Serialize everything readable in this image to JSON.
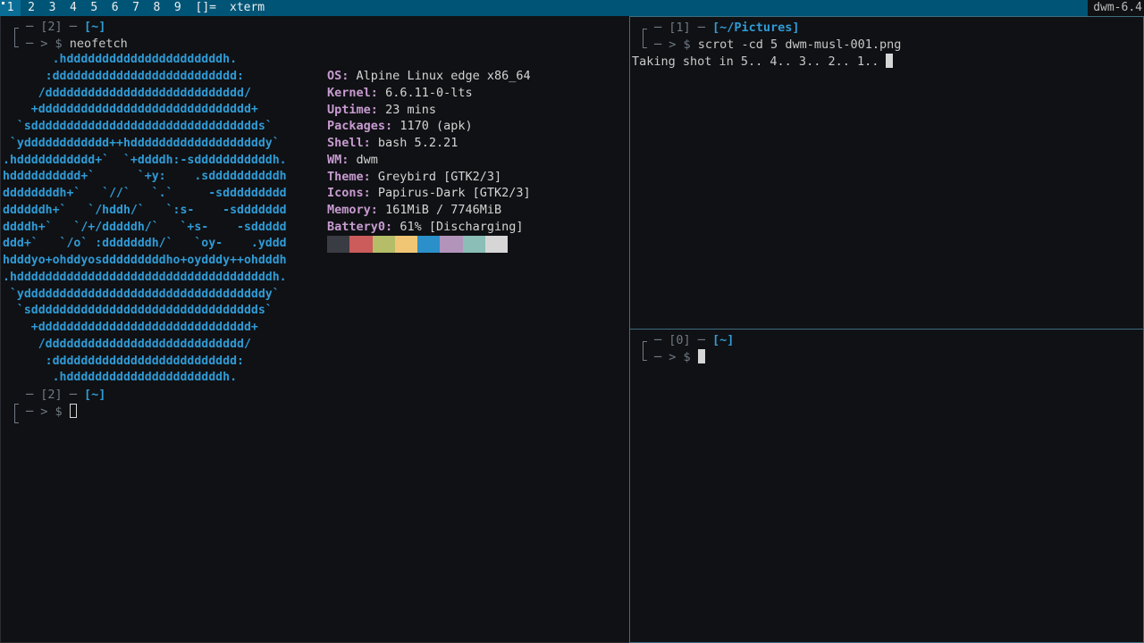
{
  "bar": {
    "tags": [
      "1",
      "2",
      "3",
      "4",
      "5",
      "6",
      "7",
      "8",
      "9"
    ],
    "selected_tag": 0,
    "layout_symbol": "[]=",
    "window_title": "xterm",
    "status": "dwm-6.4"
  },
  "main": {
    "prompt1": {
      "prefix": "─ [2] ─ ",
      "dir": "[~]",
      "arrow": "─ > $ ",
      "command": "neofetch"
    },
    "ascii": [
      "       .hddddddddddddddddddddddh.",
      "      :dddddddddddddddddddddddddd:",
      "     /dddddddddddddddddddddddddddd/",
      "    +dddddddddddddddddddddddddddddd+",
      "  `sdddddddddddddddddddddddddddddddds`",
      " `ydddddddddddd++hdddddddddddddddddddy`",
      ".hddddddddddd+`  `+ddddh:-sdddddddddddh.",
      "hdddddddddd+`      `+y:    .sddddddddddh",
      "ddddddddh+`   `//`   `.`     -sddddddddd",
      "ddddddh+`   `/hddh/`   `:s-    -sddddddd",
      "ddddh+`   `/+/dddddh/`   `+s-    -sddddd",
      "ddd+`   `/o` :dddddddh/`   `oy-    .yddd",
      "hdddyo+ohddyosdddddddddho+oydddy++ohdddh",
      ".hddddddddddddddddddddddddddddddddddddh.",
      " `yddddddddddddddddddddddddddddddddddy`",
      "  `sdddddddddddddddddddddddddddddddds`",
      "    +dddddddddddddddddddddddddddddd+",
      "     /dddddddddddddddddddddddddddd/",
      "      :dddddddddddddddddddddddddd:",
      "       .hddddddddddddddddddddddh."
    ],
    "info": [
      {
        "key": "OS",
        "value": "Alpine Linux edge x86_64"
      },
      {
        "key": "Kernel",
        "value": "6.6.11-0-lts"
      },
      {
        "key": "Uptime",
        "value": "23 mins"
      },
      {
        "key": "Packages",
        "value": "1170 (apk)"
      },
      {
        "key": "Shell",
        "value": "bash 5.2.21"
      },
      {
        "key": "WM",
        "value": "dwm"
      },
      {
        "key": "Theme",
        "value": "Greybird [GTK2/3]"
      },
      {
        "key": "Icons",
        "value": "Papirus-Dark [GTK2/3]"
      },
      {
        "key": "Memory",
        "value": "161MiB / 7746MiB"
      },
      {
        "key": "Battery0",
        "value": "61% [Discharging]"
      }
    ],
    "palette": [
      "#3a3c43",
      "#cc5b5b",
      "#b5bd68",
      "#f0c674",
      "#2b8fc9",
      "#b294bb",
      "#8abeb7",
      "#d6d6d6"
    ],
    "prompt2": {
      "prefix": "─ [2] ─ ",
      "dir": "[~]",
      "arrow": "─ > $ "
    }
  },
  "pictures": {
    "prompt": {
      "prefix": "─ [1] ─ ",
      "dir": "[~/Pictures]",
      "arrow": "─ > $ ",
      "command": "scrot -cd 5 dwm-musl-001.png"
    },
    "output": "Taking shot in 5.. 4.. 3.. 2.. 1.. "
  },
  "small": {
    "prompt": {
      "prefix": "─ [0] ─ ",
      "dir": "[~]",
      "arrow": "─ > $ "
    }
  }
}
